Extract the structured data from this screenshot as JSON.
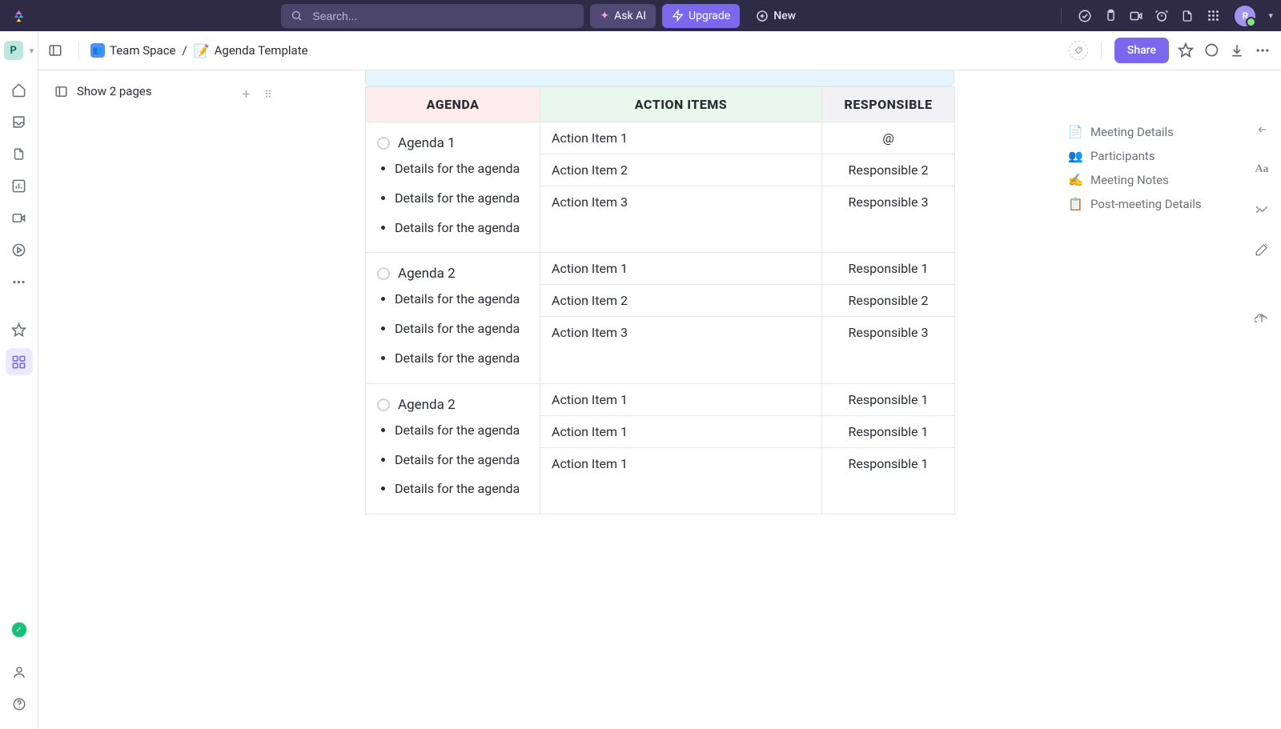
{
  "topbar": {
    "search_placeholder": "Search...",
    "ask_ai": "Ask AI",
    "upgrade": "Upgrade",
    "new": "New",
    "avatar_letter": "R"
  },
  "breadcrumb": {
    "workspace_letter": "P",
    "space_name": "Team Space",
    "page_emoji": "📝",
    "page_name": "Agenda Template",
    "share": "Share"
  },
  "pages": {
    "toggle_label": "Show 2 pages"
  },
  "table": {
    "headers": {
      "c1": "AGENDA",
      "c2": "ACTION ITEMS",
      "c3": "RESPONSIBLE"
    },
    "rows": [
      {
        "title": "Agenda 1",
        "details": [
          "Details for the agen­da",
          "Details for the agen­da",
          "Details for the agen­da"
        ],
        "actions": [
          "Action Item 1",
          "Action Item 2",
          "Action Item 3"
        ],
        "responsible": [
          "@",
          "Responsible 2",
          "Responsible 3"
        ]
      },
      {
        "title": "Agenda 2",
        "details": [
          "Details for the agen­da",
          "Details for the agen­da",
          "Details for the agen­da"
        ],
        "actions": [
          "Action Item 1",
          "Action Item 2",
          "Action Item 3"
        ],
        "responsible": [
          "Responsible 1",
          "Responsible 2",
          "Responsible 3"
        ]
      },
      {
        "title": "Agenda 2",
        "details": [
          "Details for the agen­da",
          "Details for the agen­da",
          "Details for the agen­da"
        ],
        "actions": [
          "Action Item 1",
          "Action Item 1",
          "Action Item 1"
        ],
        "responsible": [
          "Responsible 1",
          "Responsible 1",
          "Responsible 1"
        ]
      }
    ]
  },
  "outline": {
    "items": [
      {
        "emoji": "📄",
        "label": "Meeting Details"
      },
      {
        "emoji": "👥",
        "label": "Participants"
      },
      {
        "emoji": "✍️",
        "label": "Meeting Notes"
      },
      {
        "emoji": "📋",
        "label": "Post-meeting Details"
      }
    ]
  },
  "float_tools": {
    "typography": "Aa"
  }
}
